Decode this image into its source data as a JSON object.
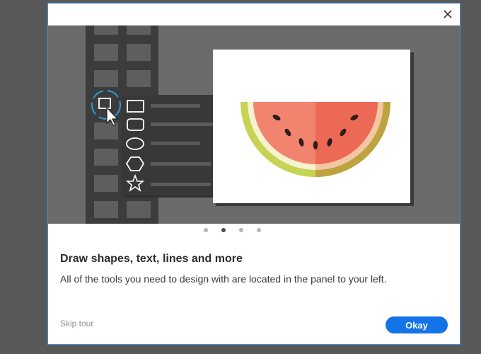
{
  "dialog": {
    "close_icon": "close-icon",
    "title": "Draw shapes, text, lines and more",
    "description": "All of the tools you need to design with are located in the panel to your left.",
    "skip_label": "Skip tour",
    "okay_label": "Okay"
  },
  "carousel": {
    "pages": 4,
    "active_index": 1
  },
  "illustration": {
    "shape_menu_icons": [
      "rectangle-icon",
      "rounded-rectangle-icon",
      "ellipse-icon",
      "hexagon-icon",
      "star-icon"
    ],
    "artwork": "watermelon-slice"
  },
  "colors": {
    "primary_button": "#1473e6",
    "hero_background": "#6b6b6b",
    "toolbar": "#3c3c3c",
    "selection_ring": "#2d9cdb"
  }
}
